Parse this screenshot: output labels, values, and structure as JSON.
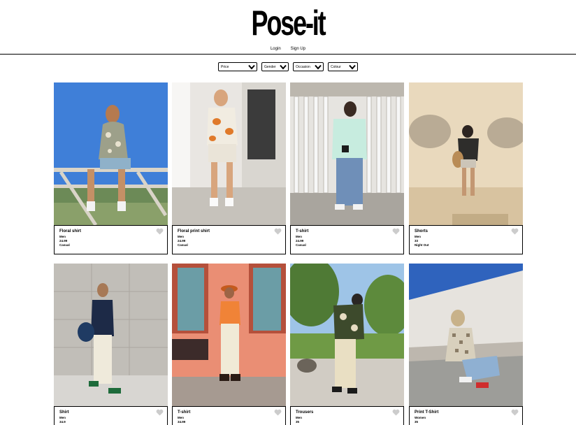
{
  "header": {
    "logo": "Pose-it",
    "login_label": "Login",
    "signup_label": "Sign Up"
  },
  "filters": {
    "price": "Price",
    "gender": "Gender",
    "occasion": "Occasion",
    "colour": "Colour"
  },
  "products": [
    {
      "name": "Floral shirt",
      "gender": "Men",
      "price": "24.99",
      "occasion": "Casual"
    },
    {
      "name": "Floral print shirt",
      "gender": "Men",
      "price": "24.99",
      "occasion": "Casual"
    },
    {
      "name": "T-shirt",
      "gender": "Men",
      "price": "24.99",
      "occasion": "Casual"
    },
    {
      "name": "Shorts",
      "gender": "Men",
      "price": "33",
      "occasion": "Night Out"
    },
    {
      "name": "Shirt",
      "gender": "Men",
      "price": "34.9",
      "occasion": ""
    },
    {
      "name": "T-shirt",
      "gender": "Men",
      "price": "34.99",
      "occasion": ""
    },
    {
      "name": "Trousers",
      "gender": "Men",
      "price": "35",
      "occasion": ""
    },
    {
      "name": "Print T-Shirt",
      "gender": "Women",
      "price": "35",
      "occasion": ""
    }
  ],
  "colors": {
    "heart": "#cccccc",
    "border": "#000000"
  }
}
